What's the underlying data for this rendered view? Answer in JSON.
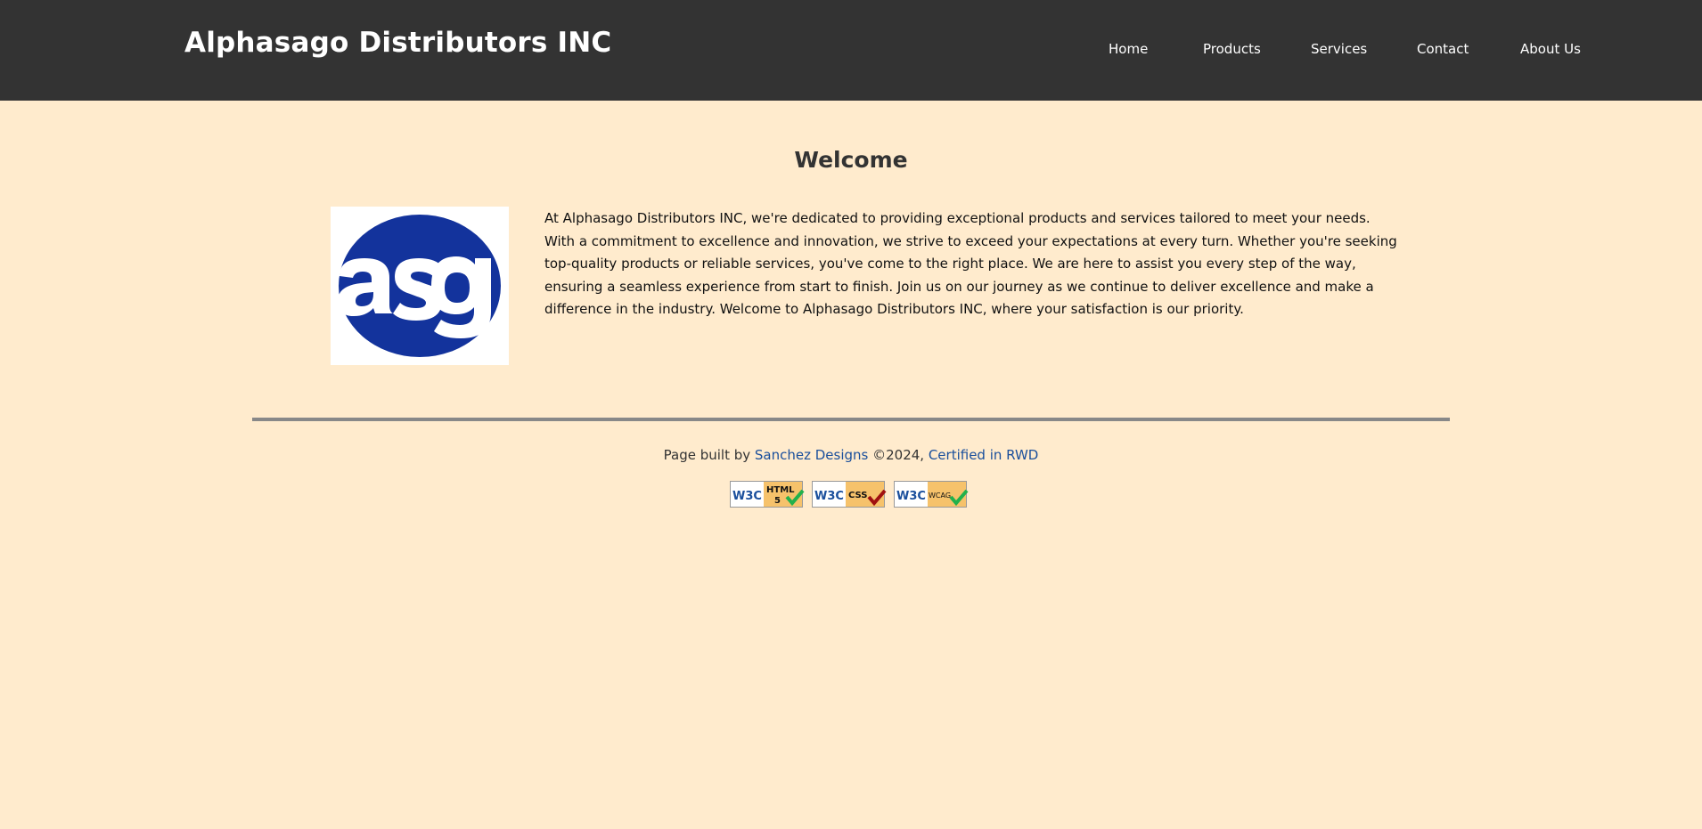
{
  "header": {
    "site_title": "Alphasago Distributors INC",
    "nav": [
      {
        "label": "Home"
      },
      {
        "label": "Products"
      },
      {
        "label": "Services"
      },
      {
        "label": "Contact"
      },
      {
        "label": "About Us"
      }
    ]
  },
  "main": {
    "heading": "Welcome",
    "logo_text": "asg",
    "intro": "At Alphasago Distributors INC, we're dedicated to providing exceptional products and services tailored to meet your needs. With a commitment to excellence and innovation, we strive to exceed your expectations at every turn. Whether you're seeking top-quality products or reliable services, you've come to the right place. We are here to assist you every step of the way, ensuring a seamless experience from start to finish. Join us on our journey as we continue to deliver excellence and make a difference in the industry. Welcome to Alphasago Distributors INC, where your satisfaction is our priority."
  },
  "footer": {
    "prefix": "Page built by ",
    "designer_link": "Sanchez Designs",
    "middle": " ©2024, ",
    "cert_link": "Certified in RWD",
    "badges": [
      {
        "w3c": "W3C",
        "label": "HTML 5",
        "check_color": "#22b14c"
      },
      {
        "w3c": "W3C",
        "label": "CSS",
        "check_color": "#a01010"
      },
      {
        "w3c": "W3C",
        "label": "WCAG",
        "check_color": "#22b14c"
      }
    ]
  },
  "colors": {
    "header_bg": "#333333",
    "page_bg": "#ffebcd",
    "logo_blue": "#13339c",
    "link": "#1a4f9c",
    "badge_bg": "#f6c26b"
  }
}
